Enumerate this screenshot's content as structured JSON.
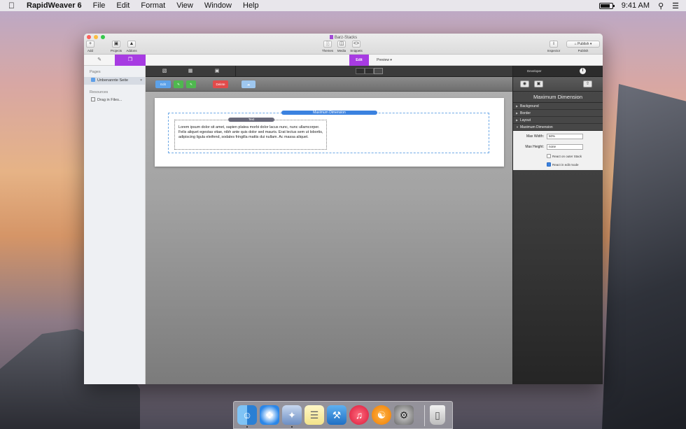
{
  "menubar": {
    "app_name": "RapidWeaver 6",
    "menus": [
      "File",
      "Edit",
      "Format",
      "View",
      "Window",
      "Help"
    ],
    "clock": "9:41 AM"
  },
  "window": {
    "title": "Barz-Stacks",
    "toolbar": {
      "add": "Add",
      "projects": "Projects",
      "addons": "Addons",
      "themes": "Themes",
      "media": "Media",
      "snippets": "Snippets",
      "inspector": "Inspector",
      "publish": "Publish",
      "publish_button": "Publish"
    },
    "modes": {
      "edit": "Edit",
      "preview": "Preview"
    }
  },
  "sidebar": {
    "pages_header": "Pages",
    "page_item": "Unbenannte Seite",
    "resources_header": "Resources",
    "drag_label": "Drag in Files..."
  },
  "stacks": {
    "edit": "Edit",
    "delete": "Delete",
    "maxdim_label": "Maximum Dimension",
    "text_label": "Text",
    "body_text": "Lorem ipsum dolor sit amet, sapien platea morbi dolor lacus nunc, nunc ullamcorper. Felis aliquet egestas vitae, nibh ante quis dolor sed mauris. Erat lectus sem ut lobortis, adipiscing ligula eleifend, sodales fringilla mattis dui nullam. Ac massa aliquet."
  },
  "inspector": {
    "developer": "Developer",
    "title": "Maximum Dimension",
    "sections": [
      "Background",
      "Border",
      "Layout",
      "Maximum Dimension"
    ],
    "max_width_label": "Max Width:",
    "max_width_value": "50%",
    "max_height_label": "Max Height:",
    "max_height_value": "none",
    "react_outer": "React on outer Stack",
    "react_outer_checked": false,
    "react_edit": "React in edit mode",
    "react_edit_checked": true
  },
  "dock": {
    "items": [
      "finder-icon",
      "safari-icon",
      "rapidweaver-icon",
      "notes-icon",
      "xcode-icon",
      "itunes-icon",
      "ibooks-icon",
      "system-preferences-icon",
      "trash-icon"
    ]
  },
  "colors": {
    "accent": "#a73be2",
    "blue": "#3b82e0"
  }
}
